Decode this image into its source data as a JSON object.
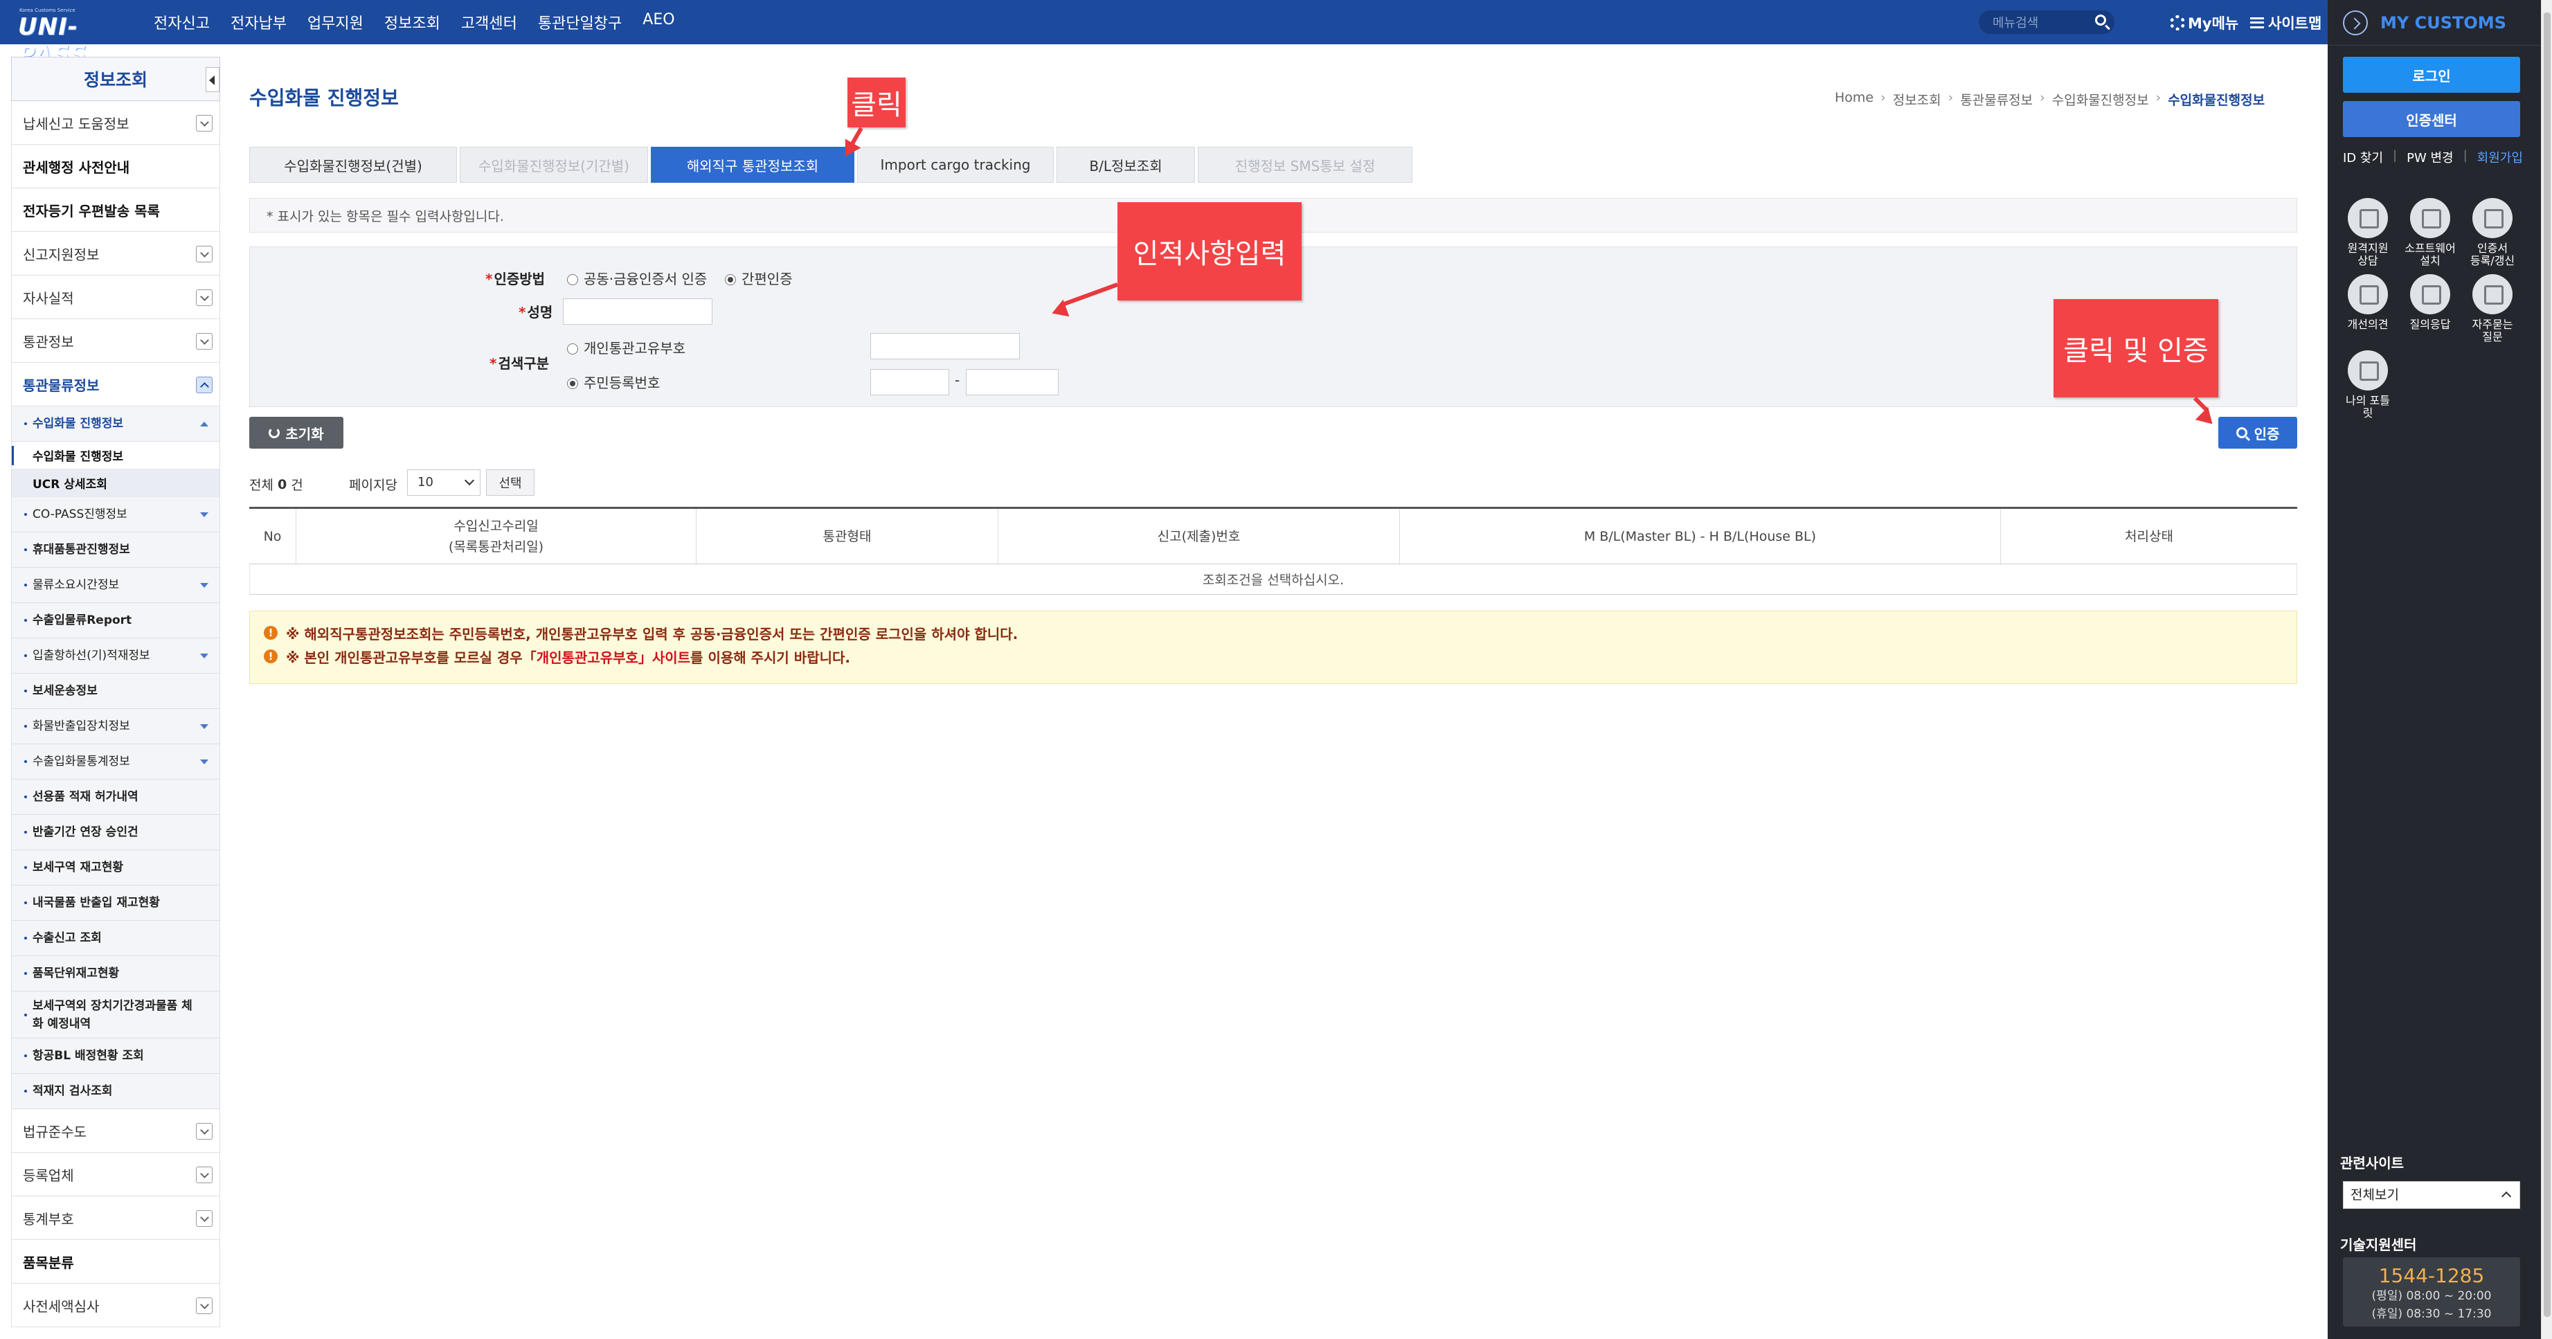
{
  "header": {
    "logo_text": "UNI-PASS",
    "logo_subtext": "Korea Customs Service",
    "nav": [
      "전자신고",
      "전자납부",
      "업무지원",
      "정보조회",
      "고객센터",
      "통관단일창구",
      "AEO"
    ],
    "search_placeholder": "메뉴검색",
    "my_menu": "My메뉴",
    "sitemap": "사이트맵"
  },
  "sidebar": {
    "title": "정보조회",
    "items": [
      {
        "label": "납세신고 도움정보"
      },
      {
        "label": "관세행정 사전안내"
      },
      {
        "label": "전자등기 우편발송 목록"
      },
      {
        "label": "신고지원정보"
      },
      {
        "label": "자사실적"
      },
      {
        "label": "통관정보"
      },
      {
        "label": "통관물류정보"
      }
    ],
    "sub_cargo": "수입화물 진행정보",
    "leaves": [
      "수입화물 진행정보",
      "UCR 상세조회"
    ],
    "subs": [
      "CO-PASS진행정보",
      "휴대품통관진행정보",
      "물류소요시간정보",
      "수출입물류Report",
      "입출항하선(기)적재정보",
      "보세운송정보",
      "화물반출입장치정보",
      "수출입화물통계정보",
      "선용품 적재 허가내역",
      "반출기간 연장 승인건",
      "보세구역 재고현황",
      "내국물품 반출입 재고현황",
      "수출신고 조회",
      "품목단위재고현황",
      "보세구역외 장치기간경과물품 체화 예정내역",
      "항공BL 배정현황 조회",
      "적재지 검사조회"
    ],
    "bottom_items": [
      "법규준수도",
      "등록업체",
      "통계부호",
      "품목분류",
      "사전세액심사"
    ]
  },
  "main": {
    "title": "수입화물 진행정보",
    "breadcrumb": [
      "Home",
      "정보조회",
      "통관물류정보",
      "수입화물진행정보",
      "수입화물진행정보"
    ],
    "tabs": [
      {
        "label": "수입화물진행정보(건별)"
      },
      {
        "label": "수입화물진행정보(기간별)"
      },
      {
        "label": "해외직구 통관정보조회"
      },
      {
        "label": "Import cargo tracking"
      },
      {
        "label": "B/L정보조회"
      },
      {
        "label": "진행정보 SMS통보 설정"
      }
    ],
    "required_notice": "* 표시가 있는 항목은 필수 입력사항입니다.",
    "form": {
      "auth_label": "인증방법",
      "auth_opt1": "공동·금융인증서 인증",
      "auth_opt2": "간편인증",
      "name_label": "성명",
      "search_label": "검색구분",
      "search_opt1": "개인통관고유부호",
      "search_opt2": "주민등록번호",
      "dash": "-"
    },
    "reset_button": "초기화",
    "auth_button": "인증",
    "count_prefix": "전체",
    "count_value": "0",
    "count_suffix": "건",
    "per_page_label": "페이지당",
    "per_page_value": "10",
    "select_button": "선택",
    "table": {
      "headers": [
        "No",
        "수입신고수리일\n(목록통관처리일)",
        "통관형태",
        "신고(제출)번호",
        "M B/L(Master BL) - H B/L(House BL)",
        "처리상태"
      ],
      "empty": "조회조건을 선택하십시오."
    },
    "warnings": {
      "line1": "※ 해외직구통관정보조회는 주민등록번호, 개인통관고유부호 입력 후 공동·금융인증서 또는 간편인증 로그인을 하셔야 합니다.",
      "line2_pre": "※ 본인 개인통관고유부호를 모르실 경우「",
      "line2_link": "개인통관고유부호」사이트",
      "line2_post": "를 이용해 주시기 바랍니다."
    }
  },
  "annotations": {
    "click": "클릭",
    "enter_info": "인적사항입력",
    "click_auth": "클릭 및 인증"
  },
  "right_panel": {
    "title": "MY CUSTOMS",
    "login": "로그인",
    "cert_center": "인증센터",
    "links": [
      "ID 찾기",
      "PW 변경",
      "회원가입"
    ],
    "icons": [
      {
        "label": "원격지원\n상담",
        "icon": "remote-support-icon"
      },
      {
        "label": "소프트웨어\n설치",
        "icon": "software-install-icon"
      },
      {
        "label": "인증서\n등록/갱신",
        "icon": "certificate-icon"
      },
      {
        "label": "개선의견",
        "icon": "feedback-icon"
      },
      {
        "label": "질의응답",
        "icon": "qna-icon"
      },
      {
        "label": "자주묻는\n질문",
        "icon": "faq-icon"
      },
      {
        "label": "나의 포틀\n릿",
        "icon": "portlet-icon"
      }
    ],
    "related_title": "관련사이트",
    "related_select": "전체보기",
    "tech_title": "기술지원센터",
    "tech_phone": "1544-1285",
    "tech_weekday": "(평일) 08:00 ~ 20:00",
    "tech_holiday": "(휴일) 08:30 ~ 17:30"
  },
  "colors": {
    "header_bg": "#1c4a9c",
    "active_tab": "#2e6bd1",
    "annotation_red": "#f44347",
    "panel_bg": "#24272d"
  }
}
